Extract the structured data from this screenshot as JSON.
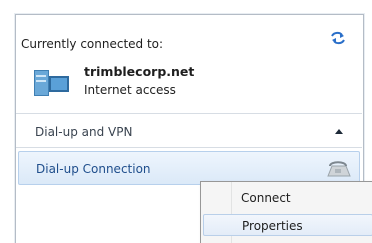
{
  "network_panel": {
    "connected_heading": "Currently connected to:",
    "network": {
      "name": "trimblecorp.net",
      "status": "Internet access"
    },
    "sections": [
      {
        "title": "Dial-up and VPN",
        "items": [
          {
            "label": "Dial-up Connection",
            "icon": "modem-phone-icon"
          }
        ]
      }
    ]
  },
  "context_menu": {
    "items": [
      {
        "label": "Connect"
      },
      {
        "label": "Properties"
      }
    ]
  },
  "colors": {
    "selected_row_bg": "#dbe9f8",
    "selected_row_border": "#b7d0ec",
    "link_text": "#1f4e8c",
    "menu_bg": "#f5f5f5"
  }
}
